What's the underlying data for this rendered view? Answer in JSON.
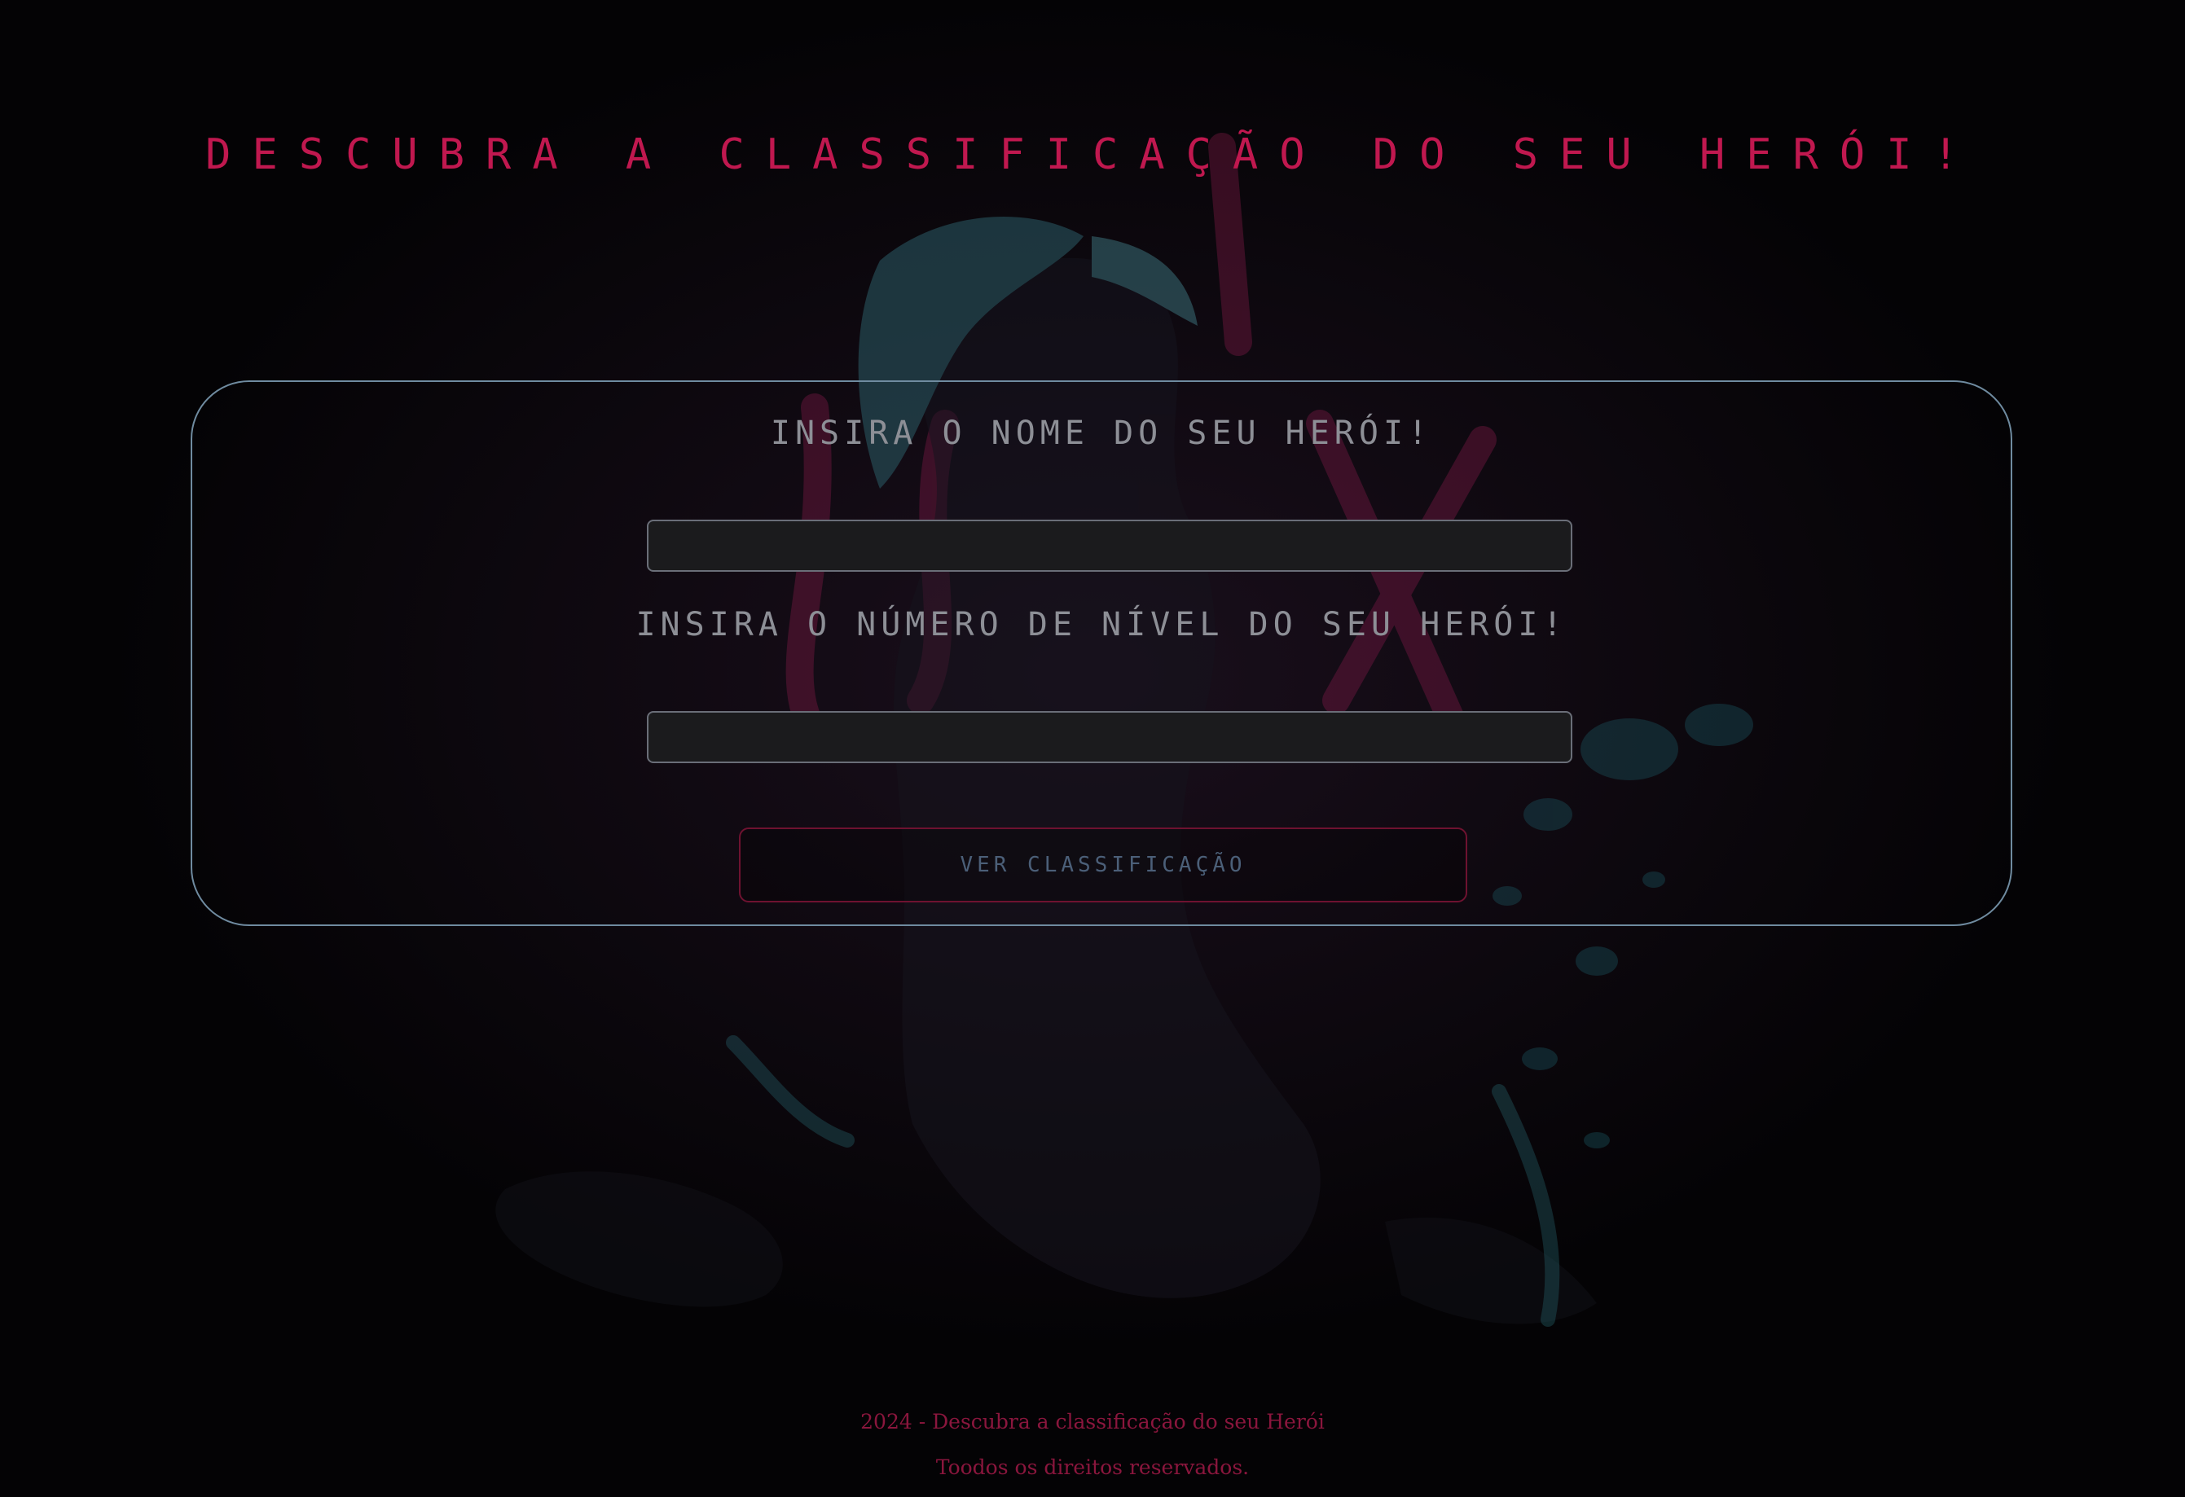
{
  "header": {
    "title": "Descubra a classificação do seu Herói!"
  },
  "form": {
    "name_label": "Insira o nome do seu herói!",
    "name_value": "",
    "level_label": "Insira o número de nível do seu herói!",
    "level_value": "",
    "submit_label": "Ver classificação"
  },
  "footer": {
    "line1": "2024 - Descubra a classificação do seu Herói",
    "line2": "Toodos os direitos reservados."
  },
  "colors": {
    "accent": "#c0184f",
    "panel_border": "#6f8ba0",
    "background": "#040305"
  },
  "icons": {
    "background": "hero-illustration"
  }
}
